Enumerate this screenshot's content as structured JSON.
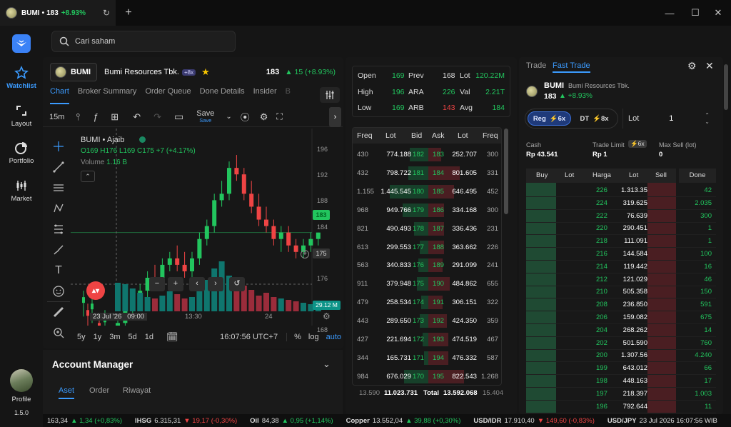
{
  "titlebar": {
    "symbol": "BUMI",
    "price": "183",
    "change": "+8.93%"
  },
  "sidebar": {
    "items": [
      {
        "label": "Watchlist"
      },
      {
        "label": "Layout"
      },
      {
        "label": "Portfolio"
      },
      {
        "label": "Market"
      }
    ],
    "profile": "Profile",
    "version": "1.5.0"
  },
  "search": {
    "placeholder": "Cari saham"
  },
  "stock": {
    "code": "BUMI",
    "name": "Bumi Resources Tbk.",
    "flag": "+8x",
    "price": "183",
    "change": "▲ 15 (+8.93%)"
  },
  "chart_tabs": [
    "Chart",
    "Broker Summary",
    "Order Queue",
    "Done Details",
    "Insider",
    "B"
  ],
  "toolbar": {
    "interval": "15m",
    "save": "Save",
    "save_sub": "Save"
  },
  "chart": {
    "title": "BUMI • Ajaib",
    "ohlc_o": "O169",
    "ohlc_h": "H176",
    "ohlc_l": "L169",
    "ohlc_c": "C175",
    "ohlc_chg": "+7 (+4.17%)",
    "volume_label": "Volume",
    "volume_value": "1.16 B",
    "price_axis": [
      "196",
      "192",
      "188",
      "184",
      "180",
      "176",
      "172",
      "168"
    ],
    "price_tag": "183",
    "cursor_tag": "175",
    "vol_tag": "29.12 M",
    "time_axis": [
      "23 Jul '26   09:00",
      "13:30",
      "24"
    ],
    "ranges": [
      "5y",
      "1y",
      "3m",
      "5d",
      "1d"
    ],
    "clock": "16:07:56 UTC+7",
    "pct": "%",
    "log": "log",
    "auto": "auto"
  },
  "chart_data": {
    "type": "candlestick",
    "ohlc": [
      [
        168,
        170,
        167,
        169
      ],
      [
        169,
        172,
        168,
        171
      ],
      [
        171,
        173,
        170,
        172
      ],
      [
        172,
        175,
        171,
        174
      ],
      [
        174,
        177,
        173,
        176
      ],
      [
        176,
        178,
        174,
        175
      ],
      [
        175,
        179,
        174,
        178
      ],
      [
        178,
        180,
        177,
        179
      ],
      [
        179,
        181,
        177,
        178
      ],
      [
        178,
        180,
        176,
        177
      ],
      [
        177,
        180,
        176,
        179
      ],
      [
        179,
        183,
        178,
        182
      ],
      [
        182,
        185,
        181,
        184
      ],
      [
        184,
        189,
        183,
        188
      ],
      [
        188,
        191,
        187,
        189
      ],
      [
        189,
        194,
        188,
        193
      ],
      [
        193,
        195,
        191,
        192
      ],
      [
        192,
        193,
        188,
        189
      ],
      [
        189,
        191,
        186,
        187
      ],
      [
        187,
        189,
        184,
        185
      ],
      [
        185,
        187,
        183,
        184
      ],
      [
        184,
        185,
        181,
        182
      ],
      [
        182,
        184,
        180,
        183
      ],
      [
        183,
        184,
        180,
        181
      ],
      [
        181,
        182,
        179,
        180
      ],
      [
        180,
        182,
        179,
        181
      ],
      [
        181,
        183,
        180,
        182
      ],
      [
        182,
        183,
        181,
        183
      ]
    ]
  },
  "order_book_top": {
    "open_l": "Open",
    "open_v": "169",
    "prev_l": "Prev",
    "prev_v": "168",
    "lot_l": "Lot",
    "lot_v": "120.22M",
    "high_l": "High",
    "high_v": "196",
    "ara_l": "ARA",
    "ara_v": "226",
    "val_l": "Val",
    "val_v": "2.21T",
    "low_l": "Low",
    "low_v": "169",
    "arb_l": "ARB",
    "arb_v": "143",
    "avg_l": "Avg",
    "avg_v": "184"
  },
  "order_book": {
    "headers": [
      "Freq",
      "Lot",
      "Bid",
      "Ask",
      "Lot",
      "Freq"
    ],
    "rows": [
      [
        "430",
        "774.188",
        "182",
        "183",
        "252.707",
        "300"
      ],
      [
        "432",
        "798.722",
        "181",
        "184",
        "801.605",
        "331"
      ],
      [
        "1.155",
        "1.445.545",
        "180",
        "185",
        "646.495",
        "452"
      ],
      [
        "968",
        "949.766",
        "179",
        "186",
        "334.168",
        "300"
      ],
      [
        "821",
        "490.493",
        "178",
        "187",
        "336.436",
        "231"
      ],
      [
        "613",
        "299.553",
        "177",
        "188",
        "363.662",
        "226"
      ],
      [
        "563",
        "340.833",
        "176",
        "189",
        "291.099",
        "241"
      ],
      [
        "911",
        "379.948",
        "175",
        "190",
        "484.862",
        "655"
      ],
      [
        "479",
        "258.534",
        "174",
        "191",
        "306.151",
        "322"
      ],
      [
        "443",
        "289.650",
        "173",
        "192",
        "424.350",
        "359"
      ],
      [
        "427",
        "221.694",
        "172",
        "193",
        "474.519",
        "467"
      ],
      [
        "344",
        "165.731",
        "171",
        "194",
        "476.332",
        "587"
      ],
      [
        "984",
        "676.029",
        "170",
        "195",
        "822.543",
        "1.268"
      ]
    ],
    "total": [
      "13.590",
      "11.023.731",
      "Total",
      "13.592.068",
      "15.404"
    ]
  },
  "trade": {
    "tabs": [
      "Trade",
      "Fast Trade"
    ],
    "code": "BUMI",
    "name": "Bumi Resources Tbk.",
    "price": "183",
    "change": "▲ +8.93%",
    "reg": "Reg",
    "reg_x": "6x",
    "dt": "DT",
    "dt_x": "8x",
    "lot_label": "Lot",
    "lot_value": "1",
    "cash_l": "Cash",
    "cash_v": "Rp 43.541",
    "tl_l": "Trade Limit",
    "tl_x": "6x",
    "tl_v": "Rp 1",
    "ms_l": "Max Sell (lot)",
    "ms_v": "0",
    "headers": [
      "Buy",
      "Lot",
      "Harga",
      "Lot",
      "Sell",
      "Done"
    ],
    "rows": [
      [
        "226",
        "1.313.35",
        "42"
      ],
      [
        "224",
        "319.625",
        "2.035"
      ],
      [
        "222",
        "76.639",
        "300"
      ],
      [
        "220",
        "290.451",
        "1"
      ],
      [
        "218",
        "111.091",
        "1"
      ],
      [
        "216",
        "144.584",
        "100"
      ],
      [
        "214",
        "119.442",
        "16"
      ],
      [
        "212",
        "121.029",
        "46"
      ],
      [
        "210",
        "505.358",
        "150"
      ],
      [
        "208",
        "236.850",
        "591"
      ],
      [
        "206",
        "159.082",
        "675"
      ],
      [
        "204",
        "268.262",
        "14"
      ],
      [
        "202",
        "501.590",
        "760"
      ],
      [
        "200",
        "1.307.56",
        "4.240"
      ],
      [
        "199",
        "643.012",
        "66"
      ],
      [
        "198",
        "448.163",
        "17"
      ],
      [
        "197",
        "218.397",
        "1.003"
      ],
      [
        "196",
        "792.644",
        "11"
      ]
    ]
  },
  "account": {
    "title": "Account Manager",
    "tabs": [
      "Aset",
      "Order",
      "Riwayat"
    ]
  },
  "ticker": [
    {
      "a": "163,34",
      "b": "▲ 1,34 (+0,83%)",
      "c": "green"
    },
    {
      "a": "IHSG",
      "b": "6.315,31",
      "c": "white"
    },
    {
      "a": "",
      "b": "▼ 19,17 (-0,30%)",
      "c": "red"
    },
    {
      "a": "Oil",
      "b": "84,38",
      "c": "white"
    },
    {
      "a": "",
      "b": "▲ 0,95 (+1,14%)",
      "c": "green"
    },
    {
      "a": "Copper",
      "b": "13.552,04",
      "c": "white"
    },
    {
      "a": "",
      "b": "▲ 39,88 (+0,30%)",
      "c": "green"
    },
    {
      "a": "USD/IDR",
      "b": "17.910,40",
      "c": "white"
    },
    {
      "a": "",
      "b": "▼ 149,60 (-0,83%)",
      "c": "red"
    },
    {
      "a": "USD/JPY",
      "b": "23 Jul 2026 16:07:56 WIB",
      "c": "white"
    }
  ],
  "colors": {
    "accent": "#3b9bff",
    "up": "#22c55e",
    "down": "#ef4444"
  }
}
